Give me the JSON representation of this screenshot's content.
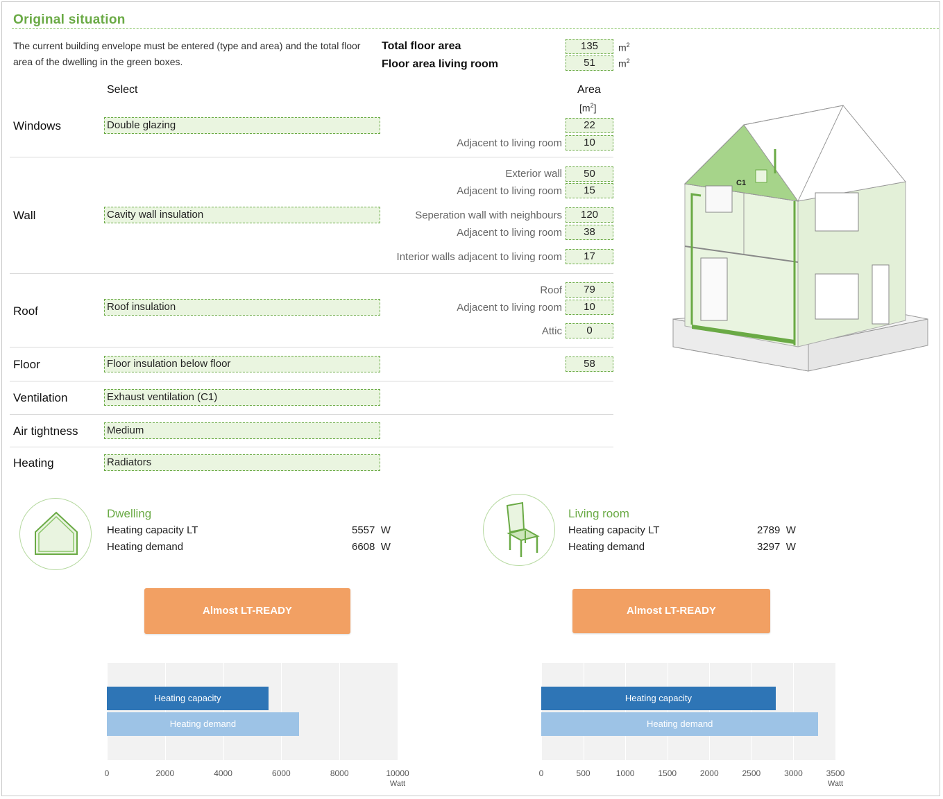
{
  "section_title": "Original situation",
  "intro_text": "The current building envelope must be entered (type and area) and the total floor area of the dwelling in the green boxes.",
  "floor": {
    "total_label": "Total floor area",
    "total_value": "135",
    "living_label": "Floor area living room",
    "living_value": "51",
    "unit": "m",
    "unit_sup": "2"
  },
  "headers": {
    "select": "Select",
    "area": "Area",
    "area_unit_open": "[m",
    "area_unit_sup": "2",
    "area_unit_close": "]"
  },
  "rows": {
    "windows": {
      "label": "Windows",
      "select": "Double glazing",
      "area": "22",
      "adjacent_label": "Adjacent to living room",
      "adjacent": "10"
    },
    "wall": {
      "label": "Wall",
      "select": "Cavity wall insulation",
      "exterior_label": "Exterior wall",
      "exterior": "50",
      "adj1_label": "Adjacent to living room",
      "adj1": "15",
      "sep_label": "Seperation wall with neighbours",
      "sep": "120",
      "adj2_label": "Adjacent to living room",
      "adj2": "38",
      "interior_label": "Interior walls adjacent to living room",
      "interior": "17"
    },
    "roof": {
      "label": "Roof",
      "select": "Roof insulation",
      "roof_label": "Roof",
      "roof": "79",
      "adj_label": "Adjacent to living room",
      "adj": "10",
      "attic_label": "Attic",
      "attic": "0"
    },
    "floor": {
      "label": "Floor",
      "select": "Floor insulation below floor",
      "area": "58"
    },
    "ventilation": {
      "label": "Ventilation",
      "select": "Exhaust ventilation (C1)"
    },
    "airtightness": {
      "label": "Air tightness",
      "select": "Medium"
    },
    "heating": {
      "label": "Heating",
      "select": "Radiators"
    }
  },
  "house_label": "C1",
  "dwelling": {
    "title": "Dwelling",
    "cap_label": "Heating capacity LT",
    "cap_value": "5557",
    "cap_unit": "W",
    "dem_label": "Heating demand",
    "dem_value": "6608",
    "dem_unit": "W",
    "status": "Almost LT-READY"
  },
  "living": {
    "title": "Living room",
    "cap_label": "Heating capacity LT",
    "cap_value": "2789",
    "cap_unit": "W",
    "dem_label": "Heating demand",
    "dem_value": "3297",
    "dem_unit": "W",
    "status": "Almost LT-READY"
  },
  "colors": {
    "accent_green": "#6aaa45",
    "status_orange": "#f2a063",
    "bar_capacity": "#2e75b6",
    "bar_demand": "#9dc3e6"
  },
  "chart_data": [
    {
      "type": "bar",
      "orientation": "horizontal",
      "categories": [
        "Heating capacity",
        "Heating demand"
      ],
      "values": [
        5557,
        6608
      ],
      "xlim": [
        0,
        10000
      ],
      "ticks": [
        "0",
        "2000",
        "4000",
        "6000",
        "8000",
        "10000"
      ],
      "xlabel": "Watt",
      "grid": true
    },
    {
      "type": "bar",
      "orientation": "horizontal",
      "categories": [
        "Heating capacity",
        "Heating demand"
      ],
      "values": [
        2789,
        3297
      ],
      "xlim": [
        0,
        3500
      ],
      "ticks": [
        "0",
        "500",
        "1000",
        "1500",
        "2000",
        "2500",
        "3000",
        "3500"
      ],
      "xlabel": "Watt",
      "grid": true
    }
  ]
}
